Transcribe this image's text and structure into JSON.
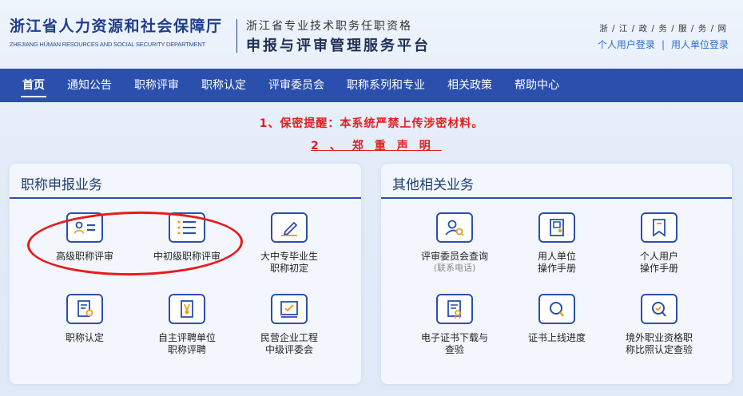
{
  "header": {
    "brand_cn": "浙江省人力资源和社会保障厅",
    "brand_en": "ZHEJIANG HUMAN RESOURCES AND SOCIAL SECURITY DEPARTMENT",
    "system_top": "浙江省专业技术职务任职资格",
    "system_main": "申报与评审管理服务平台",
    "gov_net": "浙 / 江 / 政 / 务 / 服 / 务 / 网",
    "personal_login": "个人用户登录",
    "separator": "|",
    "unit_login": "用人单位登录"
  },
  "nav": {
    "items": [
      {
        "label": "首页"
      },
      {
        "label": "通知公告"
      },
      {
        "label": "职称评审"
      },
      {
        "label": "职称认定"
      },
      {
        "label": "评审委员会"
      },
      {
        "label": "职称系列和专业"
      },
      {
        "label": "相关政策"
      },
      {
        "label": "帮助中心"
      }
    ]
  },
  "notices": {
    "line1": "1、保密提醒：本系统严禁上传涉密材料。",
    "line2": "2、郑重声明"
  },
  "left_panel": {
    "title": "职称申报业务",
    "tiles": [
      {
        "label": "高级职称评审",
        "icon": "id-card-icon"
      },
      {
        "label": "中初级职称评审",
        "icon": "list-icon"
      },
      {
        "label": "大中专毕业生\n职称初定",
        "icon": "edit-icon"
      },
      {
        "label": "职称认定",
        "icon": "certificate-icon"
      },
      {
        "label": "自主评聘单位\n职称评聘",
        "icon": "badge-icon"
      },
      {
        "label": "民营企业工程\n中级评委会",
        "icon": "check-form-icon"
      }
    ]
  },
  "right_panel": {
    "title": "其他相关业务",
    "tiles": [
      {
        "label": "评审委员会查询",
        "sub": "(联系电话)",
        "icon": "user-search-icon"
      },
      {
        "label": "用人单位\n操作手册",
        "icon": "manual-icon"
      },
      {
        "label": "个人用户\n操作手册",
        "icon": "bookmark-icon"
      },
      {
        "label": "电子证书下载与\n查验",
        "icon": "certificate-download-icon"
      },
      {
        "label": "证书上线进度",
        "icon": "search-icon"
      },
      {
        "label": "境外职业资格职\n称比照认定查验",
        "icon": "verify-search-icon"
      }
    ]
  },
  "colors": {
    "nav_bg": "#2a4fad",
    "brand": "#1f3d8f",
    "notice": "#e02020",
    "annotation_oval": "#e8191d"
  }
}
